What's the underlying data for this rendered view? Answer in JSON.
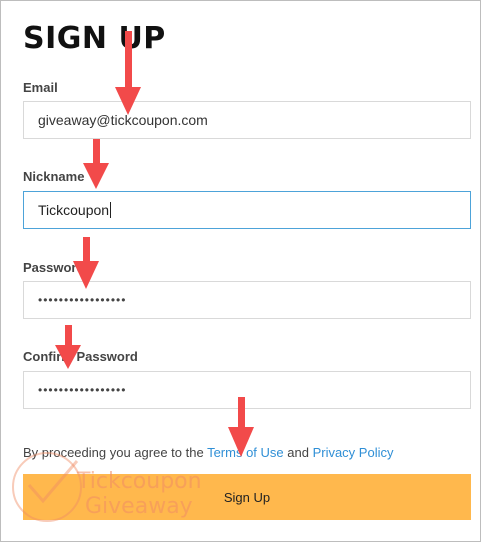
{
  "page": {
    "title": "SIGN UP"
  },
  "form": {
    "email_label": "Email",
    "email_value": "giveaway@tickcoupon.com",
    "nickname_label": "Nickname",
    "nickname_value": "Tickcoupon",
    "password_label": "Password",
    "password_value": "•••••••••••••••••",
    "confirm_label": "Confirm Password",
    "confirm_value": "•••••••••••••••••"
  },
  "agreement": {
    "prefix": "By proceeding you agree to the ",
    "terms_link": "Terms of Use",
    "middle": " and ",
    "privacy_link": "Privacy Policy"
  },
  "actions": {
    "signup_label": "Sign Up"
  },
  "watermark": {
    "line1": "Tickcoupon",
    "line2": "Giveaway"
  },
  "colors": {
    "accent_button": "#ffb84d",
    "link": "#2f8fd6",
    "focus_border": "#4da3d9",
    "annotation_arrow": "#f24a4a"
  }
}
